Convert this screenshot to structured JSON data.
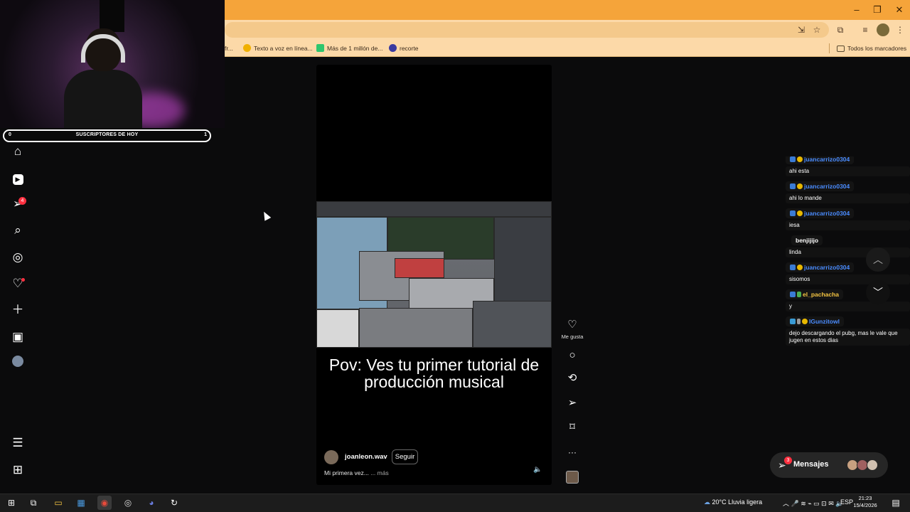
{
  "browser": {
    "bookmarks": [
      {
        "label": "fr...",
        "icon": "page-icon",
        "color": "#777777"
      },
      {
        "label": "Texto a voz en línea...",
        "icon": "smiley-icon",
        "color": "#f0b000"
      },
      {
        "label": "Más de 1 millón de...",
        "icon": "pixabay-icon",
        "color": "#2ec66d"
      },
      {
        "label": "recorte",
        "icon": "recorte-icon",
        "color": "#3a3aa0"
      }
    ],
    "all_bookmarks": "Todos los marcadores",
    "accent_color": "#f5a43a"
  },
  "overlay": {
    "subs_label": "SUSCRIPTORES DE HOY",
    "subs_current": "0",
    "subs_goal": "1"
  },
  "nav": {
    "notification_count": "4",
    "icons": [
      "home-icon",
      "reels-icon",
      "direct-icon",
      "search-icon",
      "explore-icon",
      "heart-icon",
      "create-icon",
      "dashboard-icon",
      "profile-avatar",
      "menu-icon",
      "apps-icon"
    ]
  },
  "video": {
    "caption": "Pov: Ves tu primer tutorial de producción musical",
    "author": "joanleon.wav",
    "follow_label": "Seguir",
    "description": "Mi primera vez...",
    "more_label": "... más",
    "like_label": "Me gusta"
  },
  "chat": {
    "messages": [
      {
        "user": "juancarrizo0304",
        "text": "ahi esta",
        "color": "#4a8cff"
      },
      {
        "user": "juancarrizo0304",
        "text": "ahi lo mande",
        "color": "#4a8cff"
      },
      {
        "user": "juancarrizo0304",
        "text": "iesa",
        "color": "#4a8cff"
      },
      {
        "user": "benjijijo",
        "text": "linda",
        "color": "#ffffff"
      },
      {
        "user": "juancarrizo0304",
        "text": "sisomos",
        "color": "#4a8cff"
      },
      {
        "user": "el_pachacha",
        "text": "y",
        "color": "#f5c542"
      },
      {
        "user": "IGunzitowl",
        "text": "dejo descargando el pubg, mas le vale que jugen en estos dias",
        "color": "#4a8cff"
      }
    ]
  },
  "messages_bar": {
    "label": "Mensajes",
    "count": "3"
  },
  "taskbar": {
    "weather": "20°C  Lluvia ligera",
    "language": "ESP",
    "time": "21:23",
    "date": "15/4/2026"
  }
}
